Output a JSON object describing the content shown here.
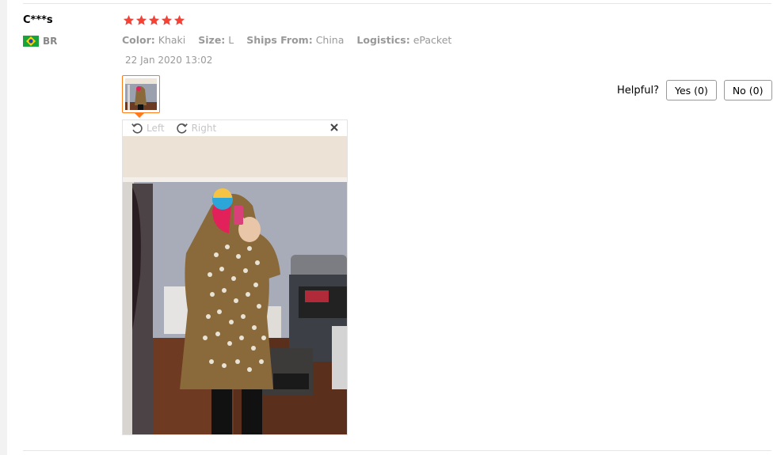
{
  "review": {
    "user_name": "C***s",
    "country_code": "BR",
    "rating": 5,
    "attributes": [
      {
        "key": "Color:",
        "value": "Khaki"
      },
      {
        "key": "Size:",
        "value": "L"
      },
      {
        "key": "Ships From:",
        "value": "China"
      },
      {
        "key": "Logistics:",
        "value": "ePacket"
      }
    ],
    "date": "22 Jan 2020 13:02"
  },
  "viewer": {
    "rotate_left_label": "Left",
    "rotate_right_label": "Right"
  },
  "helpful": {
    "label": "Helpful?",
    "yes_label": "Yes (0)",
    "no_label": "No (0)"
  },
  "colors": {
    "star": "#f44336",
    "thumb_border": "#ff7a1a",
    "flag_green": "#1aa33a",
    "flag_yellow": "#ffd400",
    "flag_blue": "#1f4aa8",
    "coat": "#8a6a3a"
  },
  "icons": {
    "star": "star-icon",
    "flag": "brazil-flag-icon",
    "rotate_left": "rotate-left-icon",
    "rotate_right": "rotate-right-icon",
    "close": "close-icon"
  }
}
